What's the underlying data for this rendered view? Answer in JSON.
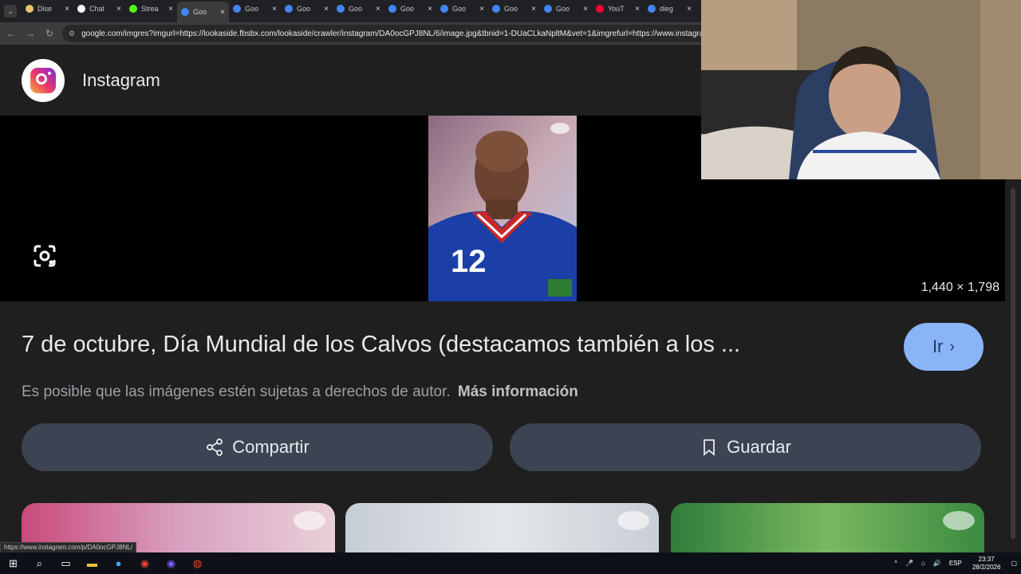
{
  "tabs": [
    {
      "title": "Dise",
      "color": "#e9c46a"
    },
    {
      "title": "Chat",
      "color": "#ffffff"
    },
    {
      "title": "Strea",
      "color": "#53fc18"
    },
    {
      "title": "Goo",
      "color": "#4285f4"
    },
    {
      "title": "Goo",
      "color": "#4285f4"
    },
    {
      "title": "Goo",
      "color": "#4285f4"
    },
    {
      "title": "Goo",
      "color": "#4285f4"
    },
    {
      "title": "Goo",
      "color": "#4285f4"
    },
    {
      "title": "Goo",
      "color": "#4285f4"
    },
    {
      "title": "Goo",
      "color": "#4285f4"
    },
    {
      "title": "Goo",
      "color": "#4285f4"
    },
    {
      "title": "YouT",
      "color": "#ff0033"
    },
    {
      "title": "dieg",
      "color": "#4285f4"
    }
  ],
  "active_tab_index": 3,
  "address": {
    "url": "google.com/imgres?imgurl=https://lookaside.fbsbx.com/lookaside/crawler/instagram/DA0ocGPJ8NL/6/image.jpg&tbnid=1-DUaCLkaNpltM&vet=1&imgrefurl=https://www.instagram.com/"
  },
  "source": {
    "name": "Instagram"
  },
  "viewer": {
    "dimensions": "1,440 × 1,798"
  },
  "result": {
    "title": "7 de octubre, Día Mundial de los Calvos (destacamos también a los ...",
    "go_label": "Ir",
    "copyright_text": "Es posible que las imágenes estén sujetas a derechos de autor.",
    "more_info": "Más información"
  },
  "actions": {
    "share": "Compartir",
    "save": "Guardar"
  },
  "status_link": "https://www.instagram.com/p/DA0ocGPJ8NL/",
  "tray": {
    "lang": "ESP",
    "time": "23:37",
    "date": "28/2/2026"
  },
  "colors": {
    "accent": "#8ab4f8",
    "button_bg": "#3c4352",
    "page_bg": "#1f1f1f"
  }
}
